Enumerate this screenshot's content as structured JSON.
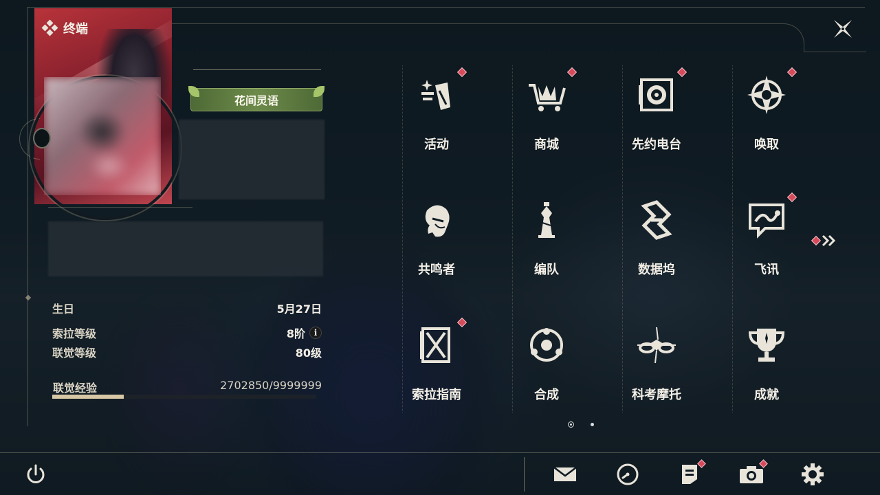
{
  "header": {
    "title": "终端"
  },
  "profile": {
    "title_badge": "花间灵语"
  },
  "stats": {
    "birthday_label": "生日",
    "birthday_value": "5月27日",
    "sola_level_label": "索拉等级",
    "sola_level_value": "8阶",
    "union_level_label": "联觉等级",
    "union_level_value": "80级",
    "exp_label": "联觉经验",
    "exp_value": "2702850/9999999",
    "exp_fraction": 0.27
  },
  "menu": [
    {
      "label": "活动",
      "icon": "event-icon",
      "badge": true
    },
    {
      "label": "商城",
      "icon": "shop-cart-icon",
      "badge": true
    },
    {
      "label": "先约电台",
      "icon": "radio-icon",
      "badge": true
    },
    {
      "label": "唤取",
      "icon": "convene-compass-icon",
      "badge": true
    },
    {
      "label": "共鸣者",
      "icon": "resonator-head-icon",
      "badge": false
    },
    {
      "label": "编队",
      "icon": "chess-team-icon",
      "badge": false
    },
    {
      "label": "数据坞",
      "icon": "data-bank-icon",
      "badge": false
    },
    {
      "label": "飞讯",
      "icon": "chat-message-icon",
      "badge": true
    },
    {
      "label": "索拉指南",
      "icon": "guidebook-icon",
      "badge": true
    },
    {
      "label": "合成",
      "icon": "synthesis-icon",
      "badge": false
    },
    {
      "label": "科考摩托",
      "icon": "motorcycle-icon",
      "badge": false
    },
    {
      "label": "成就",
      "icon": "trophy-icon",
      "badge": false
    }
  ],
  "pagination": {
    "current": 1,
    "total": 2
  },
  "bottom_bar": [
    "power-icon",
    "mail-icon",
    "clock-icon",
    "notice-icon",
    "camera-icon",
    "settings-gear-icon"
  ],
  "colors": {
    "badge_red": "#d64a5a",
    "accent_gold": "#d7c7a4",
    "title_badge_green": "#5d7a40"
  }
}
